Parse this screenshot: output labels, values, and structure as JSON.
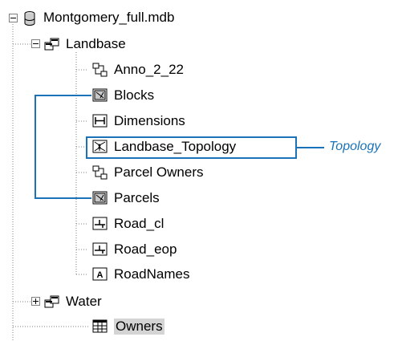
{
  "tree": {
    "root": {
      "label": "Montgomery_full.mdb",
      "icon": "database-icon",
      "expanded": true
    },
    "landbase": {
      "label": "Landbase",
      "icon": "feature-dataset-icon",
      "expanded": true
    },
    "items": [
      {
        "label": "Anno_2_22",
        "icon": "annotation-class-icon"
      },
      {
        "label": "Blocks",
        "icon": "polygon-feature-class-icon"
      },
      {
        "label": "Dimensions",
        "icon": "dimension-feature-class-icon"
      },
      {
        "label": "Landbase_Topology",
        "icon": "topology-icon"
      },
      {
        "label": "Parcel Owners",
        "icon": "relationship-class-icon"
      },
      {
        "label": "Parcels",
        "icon": "polygon-feature-class-icon"
      },
      {
        "label": "Road_cl",
        "icon": "line-feature-class-icon"
      },
      {
        "label": "Road_eop",
        "icon": "line-feature-class-icon"
      },
      {
        "label": "RoadNames",
        "icon": "text-annotation-icon"
      }
    ],
    "water": {
      "label": "Water",
      "icon": "feature-dataset-icon",
      "expanded": false
    },
    "owners": {
      "label": "Owners",
      "icon": "table-icon",
      "selected": true
    }
  },
  "callout": {
    "label": "Topology",
    "color": "#1a73b8"
  }
}
